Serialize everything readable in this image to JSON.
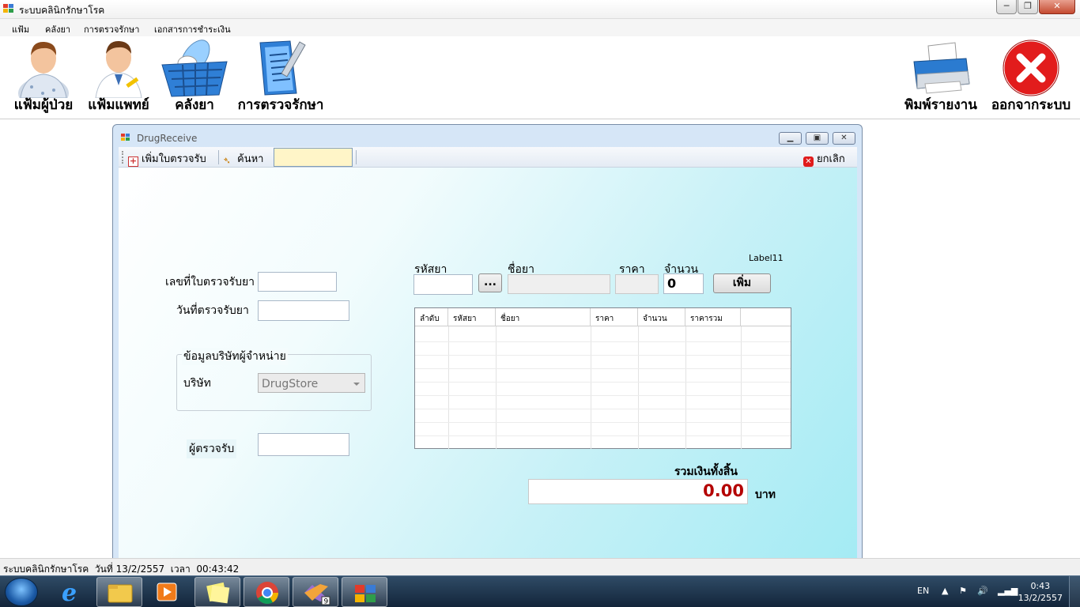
{
  "window": {
    "title": "ระบบคลินิกรักษาโรค",
    "minimize": "─",
    "maximize": "❐",
    "close": "✕"
  },
  "menu": [
    "แฟ้ม",
    "คลังยา",
    "การตรวจรักษา",
    "เอกสารการชำระเงิน"
  ],
  "toolbar": {
    "patients": "แฟ้มผู้ป่วย",
    "doctors": "แฟ้มแพทย์",
    "drugstore": "คลังยา",
    "treatment": "การตรวจรักษา",
    "print": "พิมพ์รายงาน",
    "exit": "ออกจากระบบ"
  },
  "child": {
    "title": "DrugReceive",
    "toolbar": {
      "add": "เพิ่มใบตรวจรับ",
      "search": "ค้นหา",
      "search_value": "",
      "cancel": "ยกเลิก"
    },
    "form": {
      "receipt_no_label": "เลขที่ใบตรวจรับยา",
      "receipt_no_value": "",
      "receive_date_label": "วันที่ตรวจรับยา",
      "receive_date_value": "",
      "supplier_group": "ข้อมูลบริษัทผู้จำหน่าย",
      "company_label": "บริษัท",
      "company_value": "DrugStore",
      "receiver_label": "ผู้ตรวจรับ",
      "receiver_value": ""
    },
    "entry": {
      "code_label": "รหัสยา",
      "name_label": "ชื่อยา",
      "price_label": "ราคา",
      "qty_label": "จำนวน",
      "qty_value": "0",
      "browse_button": "...",
      "add_button": "เพิ่ม",
      "label11": "Label11"
    },
    "grid": {
      "columns": [
        "ลำดับ",
        "รหัสยา",
        "ชื่อยา",
        "ราคา",
        "จำนวน",
        "ราคารวม"
      ],
      "rows": []
    },
    "total": {
      "label": "รวมเงินทั้งสิ้น",
      "value": "0.00",
      "unit": "บาท"
    }
  },
  "statusbar": {
    "app": "ระบบคลินิกรักษาโรค",
    "date_label": "วันที่",
    "date": "13/2/2557",
    "time_label": "เวลา",
    "time": "00:43:42"
  },
  "taskbar": {
    "language": "EN",
    "clock_time": "0:43",
    "clock_date": "13/2/2557",
    "badge": "9",
    "icons": [
      "windows-start-icon",
      "internet-explorer-icon",
      "file-explorer-icon",
      "media-player-icon",
      "sticky-notes-icon",
      "chrome-icon",
      "visual-studio-icon",
      "clinic-app-icon"
    ]
  }
}
